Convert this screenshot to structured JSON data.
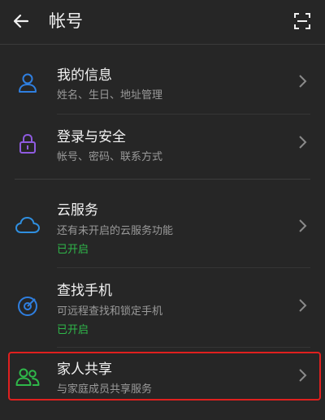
{
  "header": {
    "title": "帐号",
    "back_icon": "arrow-left-icon",
    "scan_icon": "scan-icon"
  },
  "items": [
    {
      "label": "我的信息",
      "sub": "姓名、生日、地址管理",
      "icon": "person-icon",
      "icon_color": "#2f7fe0"
    },
    {
      "label": "登录与安全",
      "sub": "帐号、密码、联系方式",
      "icon": "lock-icon",
      "icon_color": "#8f5be0"
    },
    {
      "label": "云服务",
      "sub": "还有未开启的云服务功能",
      "status": "已开启",
      "icon": "cloud-icon",
      "icon_color": "#2f8fe0"
    },
    {
      "label": "查找手机",
      "sub": "可远程查找和锁定手机",
      "status": "已开启",
      "icon": "find-phone-icon",
      "icon_color": "#2f7fe0"
    },
    {
      "label": "家人共享",
      "sub": "与家庭成员共享服务",
      "icon": "family-icon",
      "icon_color": "#2fb84a"
    }
  ],
  "colors": {
    "background": "#262626",
    "status_green": "#2fb84a",
    "highlight_red": "#e0201f"
  }
}
